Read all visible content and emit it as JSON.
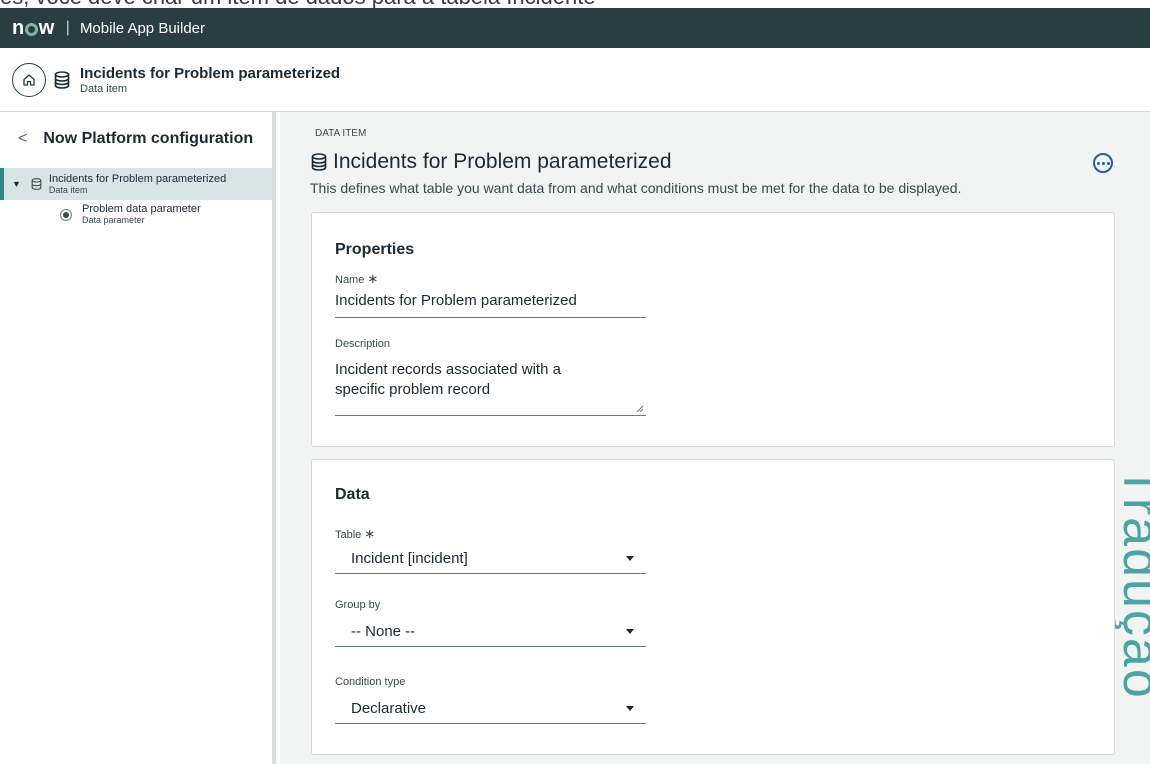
{
  "caption": "es, você deve criar um item de dados para a tabela Incidente",
  "topbar": {
    "logo": "now",
    "separator": "|",
    "app_title": "Mobile App Builder"
  },
  "header": {
    "title": "Incidents for Problem parameterized",
    "subtitle": "Data item"
  },
  "sidebar": {
    "back_label": "Now Platform configuration",
    "tree": [
      {
        "label": "Incidents for Problem parameterized",
        "sublabel": "Data item",
        "selected": true
      },
      {
        "label": "Problem data parameter",
        "sublabel": "Data parameter"
      }
    ]
  },
  "main": {
    "eyebrow": "DATA ITEM",
    "title": "Incidents for Problem parameterized",
    "description": "This defines what table you want data from and what conditions must be met for the data to be displayed."
  },
  "properties": {
    "heading": "Properties",
    "name_label": "Name",
    "required_mark": "∗",
    "name_value": "Incidents for Problem parameterized",
    "description_label": "Description",
    "description_value": "Incident records associated with a specific problem record"
  },
  "data_section": {
    "heading": "Data",
    "table_label": "Table",
    "required_mark": "∗",
    "table_value": "Incident [incident]",
    "group_by_label": "Group by",
    "group_by_value": "-- None --",
    "condition_type_label": "Condition type",
    "condition_type_value": "Declarative"
  },
  "watermark": "Tradução",
  "colors": {
    "topbar": "#293e40",
    "accent": "#2b8b8b",
    "selected_bg": "#d5e6e5",
    "link_blue": "#1f60a6",
    "watermark": "#4ba3a3"
  },
  "icons": [
    "home-icon",
    "database-icon",
    "back-chevron-icon",
    "expand-triangle-icon",
    "radio-icon",
    "more-options-icon",
    "dropdown-caret-icon",
    "resize-handle-icon"
  ]
}
